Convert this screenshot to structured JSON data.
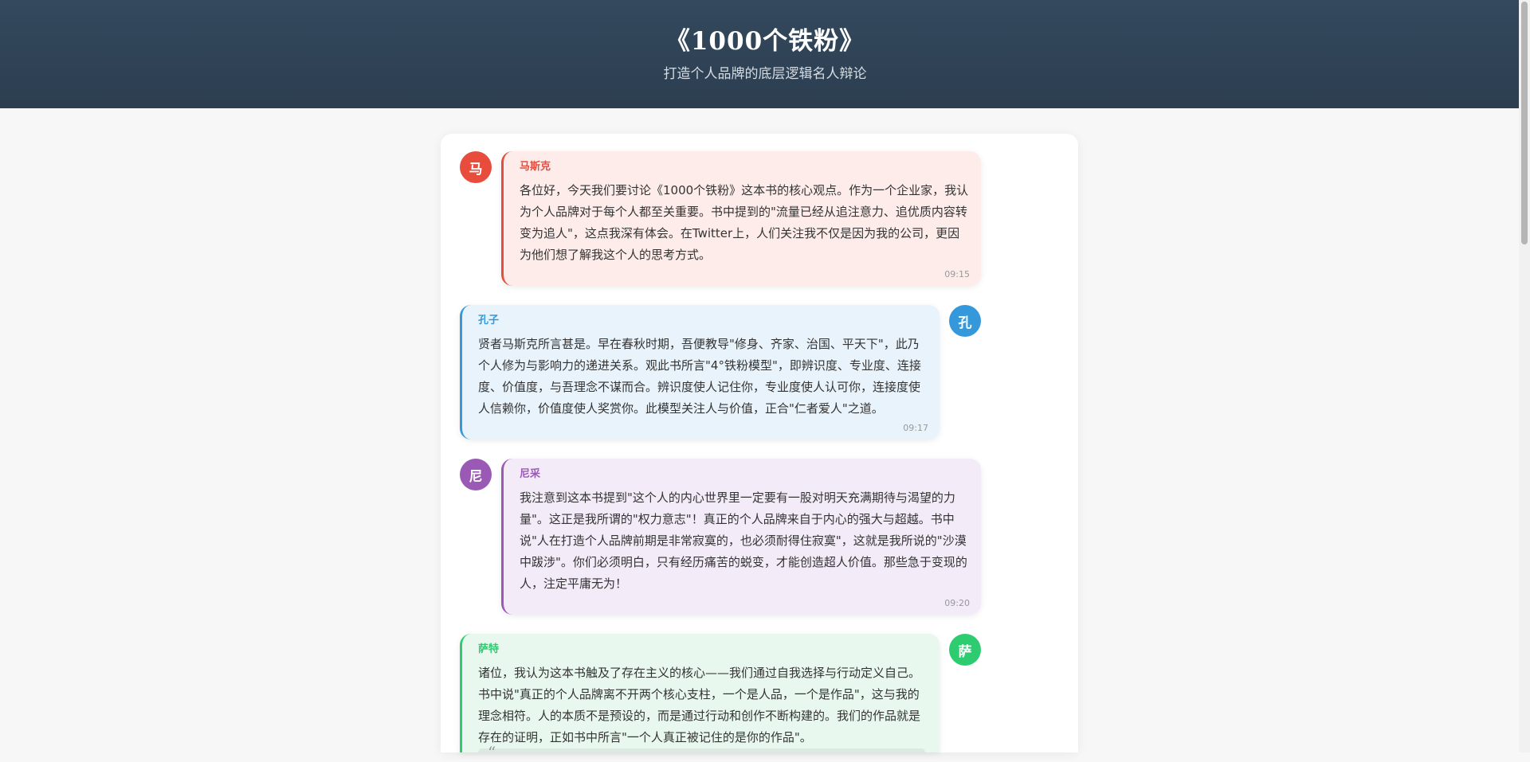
{
  "header": {
    "title": "《1000个铁粉》",
    "subtitle": "打造个人品牌的底层逻辑名人辩论"
  },
  "messages": [
    {
      "avatar": "马",
      "name": "马斯克",
      "color": "#e74c3c",
      "bg": "#fdecea",
      "side": "left",
      "text": "各位好，今天我们要讨论《1000个铁粉》这本书的核心观点。作为一个企业家，我认为个人品牌对于每个人都至关重要。书中提到的\"流量已经从追注意力、追优质内容转变为追人\"，这点我深有体会。在Twitter上，人们关注我不仅是因为我的公司，更因为他们想了解我这个人的思考方式。",
      "time": "09:15"
    },
    {
      "avatar": "孔",
      "name": "孔子",
      "color": "#3498db",
      "bg": "#e8f3fb",
      "side": "right",
      "text": "贤者马斯克所言甚是。早在春秋时期，吾便教导\"修身、齐家、治国、平天下\"，此乃个人修为与影响力的递进关系。观此书所言\"4°铁粉模型\"，即辨识度、专业度、连接度、价值度，与吾理念不谋而合。辨识度使人记住你，专业度使人认可你，连接度使人信赖你，价值度使人奖赏你。此模型关注人与价值，正合\"仁者爱人\"之道。",
      "time": "09:17"
    },
    {
      "avatar": "尼",
      "name": "尼采",
      "color": "#9b59b6",
      "bg": "#f3ebf8",
      "side": "left",
      "text": "我注意到这本书提到\"这个人的内心世界里一定要有一股对明天充满期待与渴望的力量\"。这正是我所谓的\"权力意志\"！真正的个人品牌来自于内心的强大与超越。书中说\"人在打造个人品牌前期是非常寂寞的，也必须耐得住寂寞\"，这就是我所说的\"沙漠中跋涉\"。你们必须明白，只有经历痛苦的蜕变，才能创造超人价值。那些急于变现的人，注定平庸无为！",
      "time": "09:20"
    },
    {
      "avatar": "萨",
      "name": "萨特",
      "color": "#2ecc71",
      "bg": "#e9f8ee",
      "side": "right",
      "text": "诸位，我认为这本书触及了存在主义的核心——我们通过自我选择与行动定义自己。书中说\"真正的个人品牌离不开两个核心支柱，一个是人品，一个是作品\"，这与我的理念相符。人的本质不是预设的，而是通过行动和创作不断构建的。我们的作品就是存在的证明，正如书中所言\"一个人真正被记住的是你的作品\"。",
      "time": ""
    }
  ]
}
